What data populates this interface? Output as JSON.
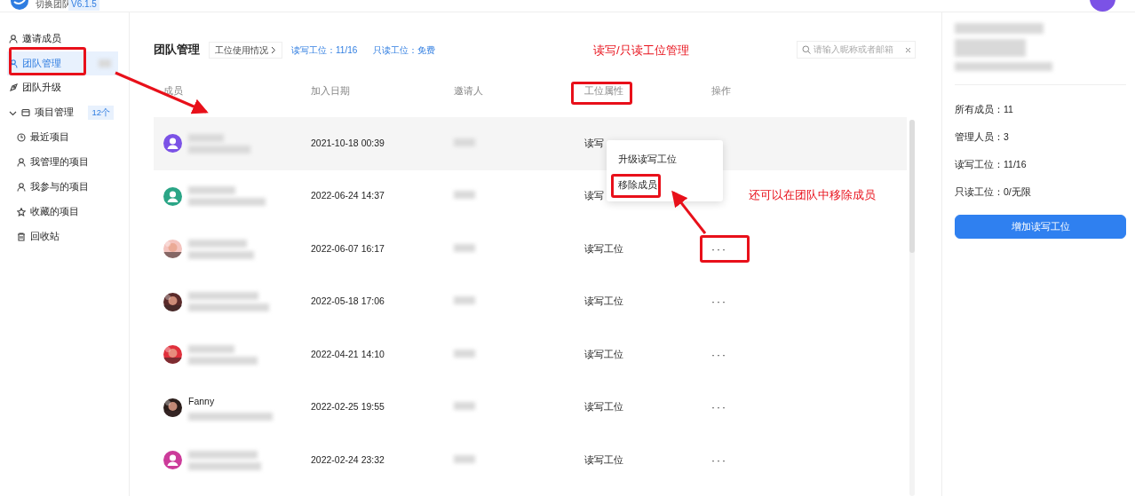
{
  "top_bar": {
    "team_switch": "切换团队",
    "version": "V6.1.5"
  },
  "sidebar": {
    "items": [
      {
        "kind": "item",
        "label": "邀请成员",
        "selected": false
      },
      {
        "kind": "item",
        "label": "团队管理",
        "selected": true
      },
      {
        "kind": "item",
        "label": "团队升级",
        "selected": false
      },
      {
        "kind": "group",
        "label": "项目管理",
        "badge": "12个",
        "selected": false,
        "expanded": true,
        "children": [
          {
            "label": "最近项目",
            "selected": false
          },
          {
            "label": "我管理的项目",
            "selected": false
          },
          {
            "label": "我参与的项目",
            "selected": false
          },
          {
            "label": "收藏的项目",
            "selected": false
          },
          {
            "label": "回收站",
            "selected": false
          }
        ]
      }
    ]
  },
  "header": {
    "title": "团队管理",
    "usage_button": "工位使用情况",
    "rw_seats": "读写工位：11/16",
    "ro_seats": "只读工位：免费",
    "search": {
      "placeholder": "请输入昵称或者邮箱"
    }
  },
  "table": {
    "columns": [
      "成员",
      "加入日期",
      "邀请人",
      "工位属性",
      "操作"
    ],
    "rows": [
      {
        "avatar": {
          "kind": "default",
          "color": "#7b52e6"
        },
        "joined": "2021-10-18 00:39",
        "seat": "读写",
        "hovered": true
      },
      {
        "avatar": {
          "kind": "default",
          "color": "#2aa586"
        },
        "joined": "2022-06-24 14:37",
        "seat": "读写"
      },
      {
        "joined": "2022-06-07 16:17",
        "seat": "读写工位",
        "action": "···"
      },
      {
        "joined": "2022-05-18 17:06",
        "seat": "读写工位",
        "action": "···"
      },
      {
        "joined": "2022-04-21 14:10",
        "seat": "读写工位",
        "action": "···"
      },
      {
        "name": "Fanny",
        "joined": "2022-02-25 19:55",
        "seat": "读写工位",
        "action": "···"
      },
      {
        "avatar": {
          "kind": "default",
          "color": "#cc3b9a"
        },
        "joined": "2022-02-24 23:32",
        "seat": "读写工位",
        "action": "···"
      }
    ]
  },
  "row_menu": {
    "items": [
      "升级读写工位",
      "移除成员"
    ]
  },
  "summary": {
    "lines": [
      "所有成员：11",
      "管理人员：3",
      "读写工位：11/16",
      "只读工位：0/无限"
    ],
    "button": "增加读写工位"
  },
  "annotations": {
    "texts": [
      "读写/只读工位管理",
      "还可以在团队中移除成员"
    ]
  }
}
